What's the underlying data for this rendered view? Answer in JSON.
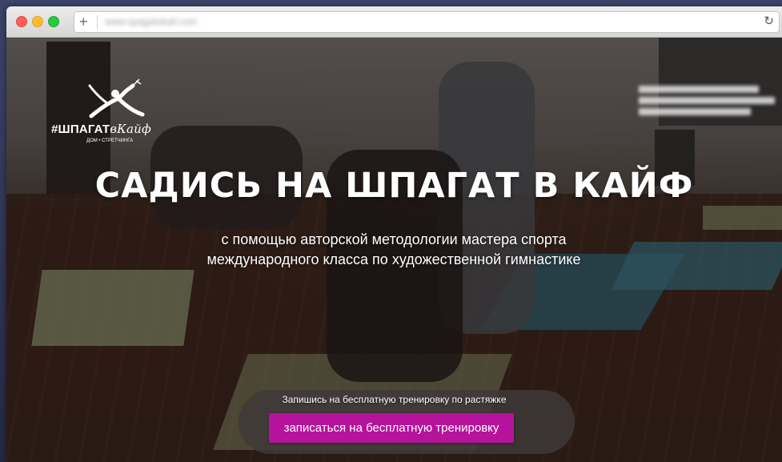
{
  "browser": {
    "new_tab_label": "+",
    "url": "www.spagatvkaif.com",
    "reload_glyph": "↻"
  },
  "logo": {
    "brand_prefix": "#ШПАГАТ",
    "brand_script": "вКайф",
    "tagline": "ДОМ • СТРЕТЧИНГА",
    "icon": "dancer-silhouette-icon"
  },
  "hero": {
    "title": "САДИСЬ НА ШПАГАТ В КАЙФ",
    "subtitle": "с помощью авторской методологии мастера спорта международного класса по художественной гимнастике"
  },
  "cta": {
    "caption": "Запишись на бесплатную тренировку по растяжке",
    "button_label": "записаться на бесплатную тренировку"
  },
  "colors": {
    "accent": "#b5139b",
    "traffic_close": "#fc5f57",
    "traffic_minimize": "#fdbc2e",
    "traffic_maximize": "#28c840"
  }
}
